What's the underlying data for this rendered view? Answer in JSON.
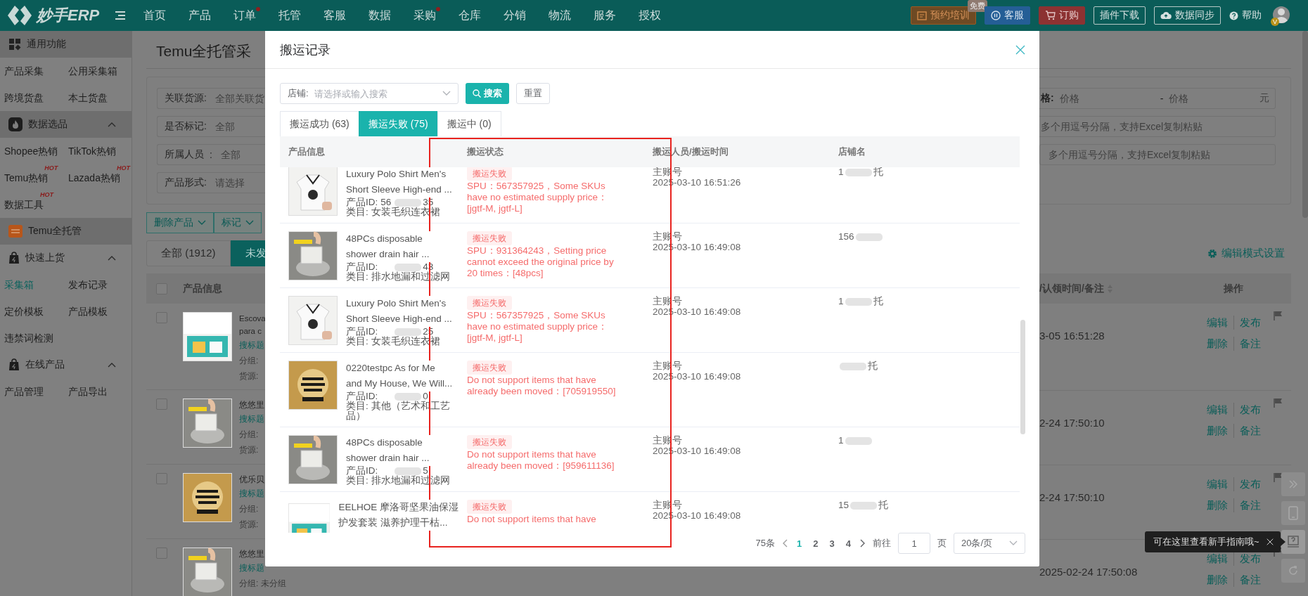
{
  "topbar": {
    "logo": "妙手ERP",
    "menu": [
      {
        "label": "首页",
        "dot": false
      },
      {
        "label": "产品",
        "dot": false
      },
      {
        "label": "订单",
        "dot": true
      },
      {
        "label": "托管",
        "dot": false
      },
      {
        "label": "客服",
        "dot": false
      },
      {
        "label": "数据",
        "dot": false
      },
      {
        "label": "采购",
        "dot": true
      },
      {
        "label": "仓库",
        "dot": false
      },
      {
        "label": "分销",
        "dot": false
      },
      {
        "label": "物流",
        "dot": false
      },
      {
        "label": "服务",
        "dot": false
      },
      {
        "label": "授权",
        "dot": false
      }
    ],
    "actions": [
      {
        "kind": "promo",
        "label": "预约培训",
        "badge": "免费"
      },
      {
        "kind": "service",
        "label": "客服"
      },
      {
        "kind": "order",
        "label": "订购"
      },
      {
        "kind": "plain",
        "label": "插件下载"
      },
      {
        "kind": "sync",
        "label": "数据同步"
      },
      {
        "kind": "help",
        "label": "帮助"
      }
    ],
    "avatar_badge": "V"
  },
  "sidebar": {
    "sections": [
      {
        "kind": "grid",
        "title": "通用功能",
        "shaded": true,
        "items": [
          {
            "label": "产品采集",
            "selected": false
          },
          {
            "label": "公用采集箱",
            "selected": false
          },
          {
            "label": "跨境货盘",
            "selected": false
          },
          {
            "label": "本土货盘",
            "selected": false
          }
        ]
      },
      {
        "kind": "fire",
        "title": "数据选品",
        "shaded": true,
        "expanded": true,
        "items": [
          {
            "label": "Shopee热销",
            "selected": false
          },
          {
            "label": "TikTok热销",
            "selected": false
          },
          {
            "label": "Temu热销",
            "badge": "HOT",
            "selected": false
          },
          {
            "label": "Lazada热销",
            "badge": "HOT",
            "selected": false
          },
          {
            "label": "数据工具",
            "badge": "HOT",
            "selected": false
          }
        ]
      },
      {
        "kind": "temu",
        "title": "Temu全托管",
        "shaded": true
      },
      {
        "kind": "bag",
        "title": "快速上货",
        "shaded": false,
        "expanded": true,
        "items": [
          {
            "label": "采集箱",
            "selected": true
          },
          {
            "label": "发布记录",
            "selected": false
          },
          {
            "label": "定价模板",
            "selected": false
          },
          {
            "label": "产品模板",
            "selected": false
          },
          {
            "label": "违禁词检测",
            "selected": false
          }
        ]
      },
      {
        "kind": "bag",
        "title": "在线产品",
        "shaded": false,
        "expanded": true,
        "items": [
          {
            "label": "产品管理",
            "selected": false
          },
          {
            "label": "产品导出",
            "selected": false
          }
        ]
      }
    ]
  },
  "page_left": {
    "title": "Temu全托管采",
    "filters": [
      {
        "label": "关联货源:",
        "help": false,
        "placeholder": "全部关联货"
      },
      {
        "label": "是否标记:",
        "help": false,
        "placeholder": "全部"
      },
      {
        "label": "所属人员",
        "help": true,
        "label_end": ":",
        "placeholder": "全部"
      },
      {
        "label": "产品形式:",
        "help": false,
        "placeholder": "请选择"
      }
    ],
    "bulk_buttons": [
      "删除产品",
      "标记"
    ],
    "tabs": [
      {
        "label": "全部 (1912)",
        "selected": false
      },
      {
        "label": "未发",
        "selected": true
      }
    ],
    "column": "产品信息",
    "header_checked": false,
    "rows": [
      {
        "checked": false,
        "title_lines": [
          "Escova",
          "para c"
        ],
        "search": "搜标题",
        "group": "分组:",
        "source": "货源:"
      },
      {
        "checked": false,
        "title_lines": [
          "悠悠里"
        ],
        "search": "搜标题",
        "group": "分组:",
        "source": "货源:"
      },
      {
        "checked": false,
        "title_lines": [
          "优乐贝"
        ],
        "search": "搜标题",
        "group": "分组:",
        "source": "货源:"
      },
      {
        "checked": false,
        "title_lines": [
          "悠悠里"
        ],
        "search": "搜标题",
        "group": "分组: 未分组"
      }
    ]
  },
  "page_right": {
    "price": {
      "label": "格:",
      "from": {
        "placeholder": "价格"
      },
      "dash": "-",
      "to": {
        "placeholder": "价格"
      },
      "unit": "元"
    },
    "text_fields": [
      {
        "placeholder": "多个用逗号分隔，支持Excel复制粘贴"
      },
      {
        "placeholder": "多个用逗号分隔，支持Excel复制粘贴"
      }
    ],
    "edit_mode": "编辑模式设置",
    "column": "/认领时间/备注",
    "ops_column": "操作",
    "rows": [
      {
        "time": "3-05 16:51:28",
        "actions": [
          "编辑",
          "发布",
          "删除",
          "备注"
        ]
      },
      {
        "time": "2-24 17:50:10",
        "actions": [
          "编辑",
          "发布",
          "删除",
          "备注"
        ]
      },
      {
        "time": "2-24 17:50:10",
        "actions": [
          "编辑",
          "发布",
          "删除",
          "备注"
        ]
      },
      {
        "time": "2025-02-24 17:50:08",
        "actions": [
          "编辑",
          "发布",
          "删除",
          "备注"
        ]
      }
    ]
  },
  "modal": {
    "title": "搬运记录",
    "shop_filter": {
      "label": "店铺:",
      "placeholder": "请选择或输入搜索"
    },
    "search": "搜索",
    "reset": "重置",
    "tabs": [
      {
        "label": "搬运成功 (63)",
        "selected": false
      },
      {
        "label": "搬运失败 (75)",
        "selected": true
      },
      {
        "label": "搬运中 (0)",
        "selected": false
      }
    ],
    "columns": [
      "产品信息",
      "搬运状态",
      "搬运人员/搬运时间",
      "店铺名"
    ],
    "rows": [
      {
        "title_lines": [
          "Luxury Polo Shirt Men's",
          "Short Sleeve High-end ..."
        ],
        "id_label": "产品ID:",
        "id_start": "56",
        "id_end": "35",
        "category_label": "类目:",
        "category": "女装毛织连衣裙",
        "status": "搬运失败",
        "message": "SPU：567357925，Some SKUs have no estimated supply price：[jgtf-M, jgtf-L]",
        "operator": "主账号",
        "time": "2025-03-10 16:51:26",
        "shop_start": "1",
        "shop_end": "托"
      },
      {
        "title_lines": [
          "48PCs disposable",
          "shower drain hair ..."
        ],
        "id_label": "产品ID:",
        "id_end": "43",
        "category_label": "类目:",
        "category": "排水地漏和过滤网",
        "status": "搬运失败",
        "message": "SPU：931364243，Setting price cannot exceed the original price by 20 times：[48pcs]",
        "operator": "主账号",
        "time": "2025-03-10 16:49:08",
        "shop_start": "156"
      },
      {
        "title_lines": [
          "Luxury Polo Shirt Men's",
          "Short Sleeve High-end ..."
        ],
        "id_label": "产品ID:",
        "id_end": "25",
        "category_label": "类目:",
        "category": "女装毛织连衣裙",
        "status": "搬运失败",
        "message": "SPU：567357925，Some SKUs have no estimated supply price：[jgtf-M, jgtf-L]",
        "operator": "主账号",
        "time": "2025-03-10 16:49:08",
        "shop_start": "1",
        "shop_end": "托"
      },
      {
        "title_lines": [
          "0220testpc As for Me",
          "and My House, We Will..."
        ],
        "id_label": "产品ID:",
        "id_end": "0",
        "category_label": "类目:",
        "category": "其他（艺术和工艺品）",
        "status": "搬运失败",
        "message": "Do not support items that have already been moved：[705919550]",
        "operator": "主账号",
        "time": "2025-03-10 16:49:08",
        "shop_end": "托"
      },
      {
        "title_lines": [
          "48PCs disposable",
          "shower drain hair ..."
        ],
        "id_label": "产品ID:",
        "id_end": "5",
        "category_label": "类目:",
        "category": "排水地漏和过滤网",
        "status": "搬运失败",
        "message": "Do not support items that have already been moved：[959611136]",
        "operator": "主账号",
        "time": "2025-03-10 16:49:08",
        "shop_start": "1"
      },
      {
        "title_lines": [
          "EELHOE 摩洛哥坚果油保湿",
          "护发套装 滋养护理干枯..."
        ],
        "status": "搬运失败",
        "message": "Do not support items that have",
        "operator": "主账号",
        "time": "2025-03-10 16:49:08",
        "shop_start": "15",
        "shop_end": "托"
      }
    ],
    "pagination": {
      "total": "75条",
      "pages": [
        {
          "label": "1",
          "selected": true
        },
        {
          "label": "2",
          "selected": false
        },
        {
          "label": "3",
          "selected": false
        },
        {
          "label": "4",
          "selected": false
        }
      ],
      "goto": "前往",
      "page_value": "1",
      "page_unit": "页",
      "page_size": "20条/页"
    }
  },
  "guide_tooltip": "可在这里查看新手指南哦~"
}
